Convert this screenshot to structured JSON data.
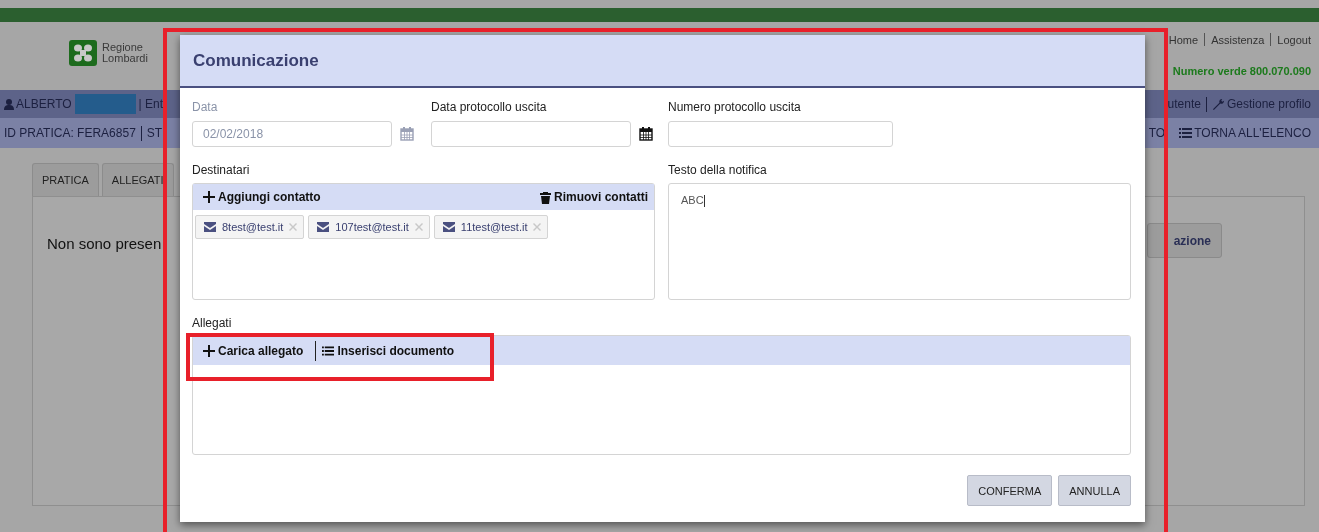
{
  "header": {
    "logo_lines": [
      "Regione",
      "Lombardi"
    ],
    "links": [
      "Home",
      "Assistenza",
      "Logout"
    ],
    "helpline": "Numero verde 800.070.090"
  },
  "user_bar": {
    "user": "ALBERTO",
    "left_fragment": "| Ent",
    "right_items": [
      "utente",
      "Gestione profilo"
    ]
  },
  "id_bar": {
    "left_items": [
      "ID PRATICA: FERA6857",
      "ST"
    ],
    "right_items": [
      "TO",
      "TORNA ALL'ELENCO"
    ]
  },
  "tabs": [
    {
      "label": "PRATICA"
    },
    {
      "label": "ALLEGATI"
    }
  ],
  "panel": {
    "message": "Non sono presen",
    "button": "azione"
  },
  "dialog": {
    "title": "Comunicazione",
    "fields": [
      {
        "label": "Data",
        "value": "02/02/2018",
        "kind": "date",
        "disabled": true
      },
      {
        "label": "Data protocollo uscita",
        "kind": "date",
        "disabled": false
      },
      {
        "label": "Numero protocollo uscita",
        "kind": "text",
        "disabled": false
      }
    ],
    "recipients": {
      "label": "Destinatari",
      "add": "Aggiungi contatto",
      "remove": "Rimuovi contatti",
      "contacts": [
        "8test@test.it",
        "107test@test.it",
        "11test@test.it"
      ]
    },
    "notification": {
      "label": "Testo della notifica",
      "value": "ABC"
    },
    "attachments": {
      "label": "Allegati",
      "actions": [
        "Carica allegato",
        "Inserisci documento"
      ]
    },
    "buttons": [
      "CONFERMA",
      "ANNULLA"
    ]
  }
}
